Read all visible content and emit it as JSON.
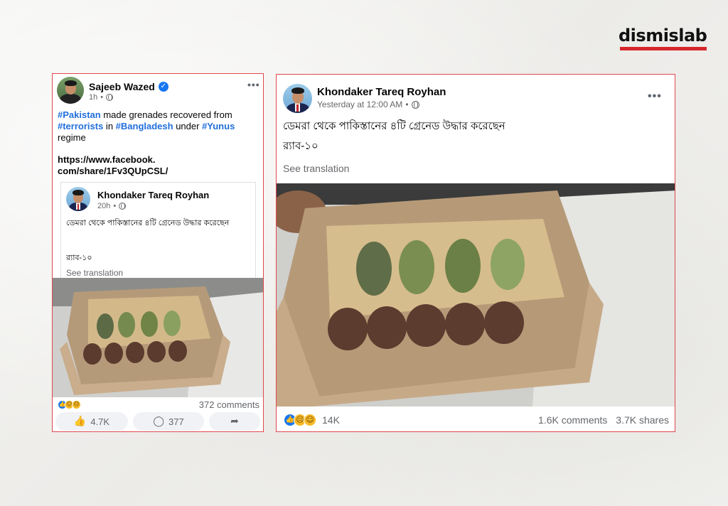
{
  "brand": {
    "logo_text": "dismislab",
    "accent_color": "#d7262b",
    "border_color": "#e0474c"
  },
  "left_post": {
    "author": "Sajeeb Wazed",
    "verified_icon": "verified-badge-icon",
    "time": "1h",
    "audience_icon": "globe-icon",
    "more_label": "•••",
    "text": {
      "t1": "#Pakistan",
      "t2": " made grenades recovered from ",
      "t3": "#terrorists",
      "t4": " in ",
      "t5": "#Bangladesh",
      "t6": " under ",
      "t7": "#Yunus",
      "t8": " regime"
    },
    "link_line1": "https://www.facebook.",
    "link_line2": "com/share/1Fv3QUpCSL/",
    "shared": {
      "author": "Khondaker Tareq Royhan",
      "time": "20h",
      "audience_icon": "globe-icon",
      "line1": "ডেমরা থেকে পাকিস্তানের ৪টি গ্রেনেড উদ্ধার করেছেন",
      "line2": "র‍্যাব-১০",
      "see_translation": "See translation"
    },
    "reactions": {
      "icons": [
        "like-icon",
        "haha-icon",
        "sad-icon"
      ],
      "comments": "372 comments"
    },
    "actions": {
      "like_count": "4.7K",
      "comment_count": "377",
      "share_icon": "share-icon"
    }
  },
  "right_post": {
    "author": "Khondaker Tareq Royhan",
    "time": "Yesterday at 12:00 AM",
    "audience_icon": "globe-icon",
    "more_label": "•••",
    "line1": "ডেমরা থেকে পাকিস্তানের ৪টি গ্রেনেড উদ্ধার করেছেন",
    "line2": "র‍্যাব-১০",
    "see_translation": "See translation",
    "reactions": {
      "icons": [
        "like-icon",
        "sad-icon",
        "haha-icon"
      ],
      "count": "14K"
    },
    "comments": "1.6K comments",
    "shares": "3.7K shares"
  }
}
